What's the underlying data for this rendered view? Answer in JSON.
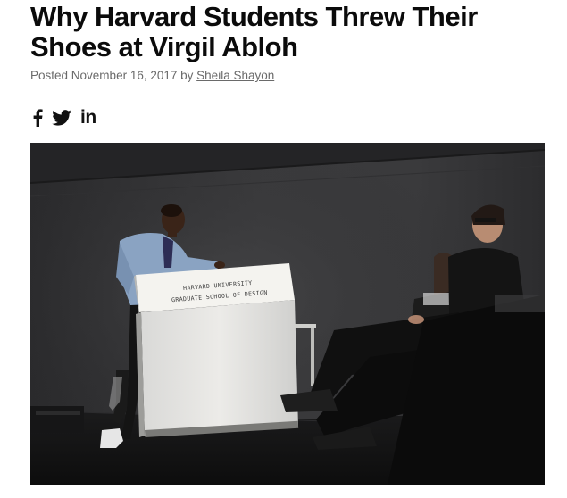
{
  "article": {
    "title": "Why Harvard Students Threw Their Shoes at Virgil Abloh",
    "posted_prefix": "Posted",
    "date": "November 16, 2017",
    "by": "by",
    "author": "Sheila Shayon"
  },
  "share": {
    "icons": [
      "facebook-icon",
      "twitter-icon",
      "linkedin-icon"
    ],
    "linkedin_text": "in"
  },
  "photo": {
    "podium_line1": "HARVARD UNIVERSITY",
    "podium_line2": "GRADUATE SCHOOL OF DESIGN"
  },
  "colors": {
    "headline": "#0b0b0b",
    "byline": "#6a6a6a",
    "photo_bg": "#1d1d1e"
  }
}
